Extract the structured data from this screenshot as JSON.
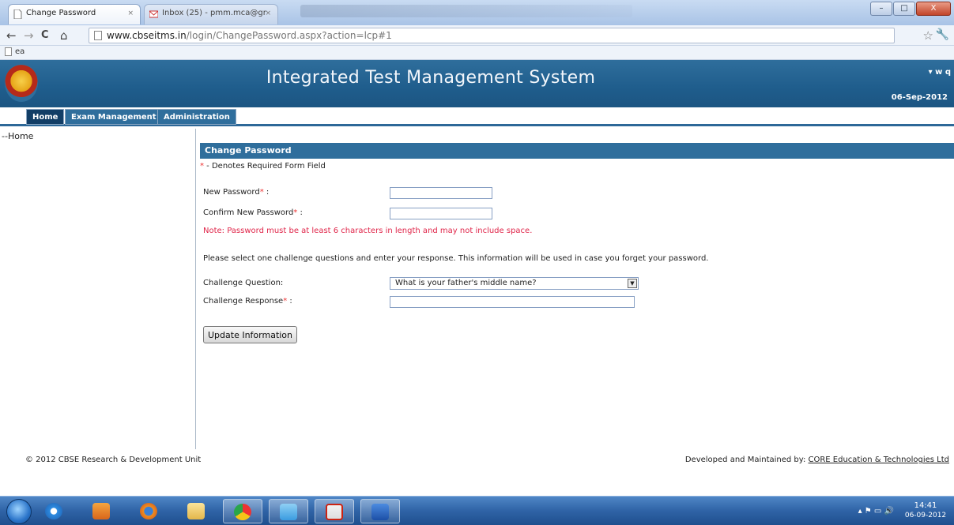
{
  "browser": {
    "tabs": [
      {
        "label": "Change Password",
        "close": "×"
      },
      {
        "label": "Inbox (25) - pmm.mca@gr",
        "close": "×"
      }
    ],
    "window_buttons": {
      "minimize": "–",
      "maximize": "□",
      "close": "X"
    },
    "nav": {
      "back": "←",
      "forward": "→",
      "reload": "C",
      "home": "⌂"
    },
    "url_host": "www.cbseitms.in",
    "url_path": "/login/ChangePassword.aspx?action=lcp#1",
    "star": "☆",
    "wrench": "🔧",
    "bookmark": "ea"
  },
  "header": {
    "title": "Integrated Test Management System",
    "user_menu": "▾ w q",
    "date": "06-Sep-2012"
  },
  "menu": {
    "home": "Home",
    "exam": "Exam Management",
    "admin": "Administration"
  },
  "sidebar": {
    "item": "--Home"
  },
  "form": {
    "panel_title": "Change Password",
    "req_star": "*",
    "req_note": " - Denotes Required Form Field",
    "new_password_label": "New Password",
    "confirm_label": "Confirm New Password",
    "colon": " :",
    "note": "Note: Password must be at least 6 characters in length and may not include space.",
    "info": "Please select one challenge questions and enter your response. This information will be used in case you forget your password.",
    "question_label": "Challenge Question:",
    "question_value": "What is your father's middle name?",
    "response_label": "Challenge Response",
    "update_button": "Update Information"
  },
  "footer": {
    "left": "© 2012 CBSE Research & Development Unit",
    "right_prefix": "Developed and Maintained by: ",
    "right_link": "CORE Education & Technologies Ltd"
  },
  "taskbar": {
    "tray_icons": "▴  ⚑  ▭  🔊",
    "time": "14:41",
    "date": "06-09-2012"
  },
  "colors": {
    "brand": "#2f6e9c",
    "required": "#e33333",
    "note": "#e0264a"
  }
}
